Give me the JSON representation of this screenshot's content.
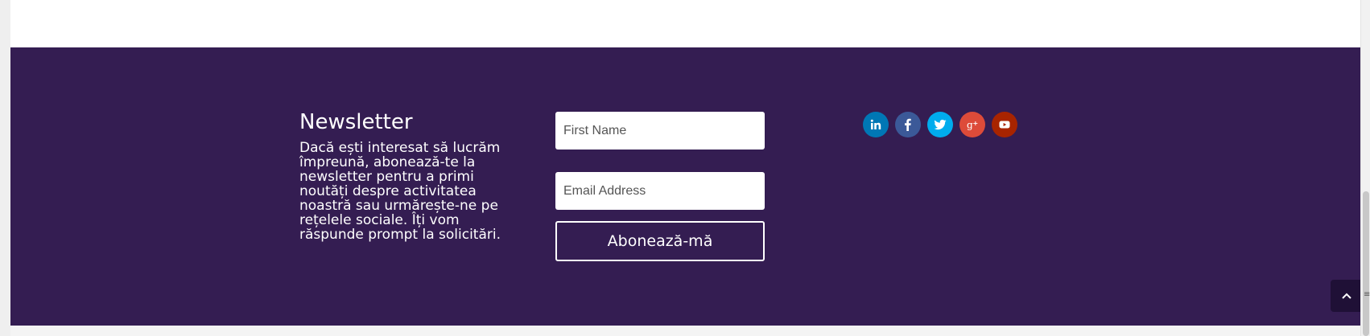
{
  "newsletter": {
    "title": "Newsletter",
    "description": "Dacă ești interesat să lucrăm împreună, abonează-te la newsletter pentru a primi noutăți despre activitatea noastră sau urmărește-ne pe rețelele sociale. Îți vom răspunde prompt la solicitări."
  },
  "form": {
    "first_name_placeholder": "First Name",
    "email_placeholder": "Email Address",
    "subscribe_label": "Abonează-mă"
  },
  "social": [
    {
      "icon": "linkedin-icon",
      "color": "#0077b5"
    },
    {
      "icon": "facebook-icon",
      "color": "#3b5998"
    },
    {
      "icon": "twitter-icon",
      "color": "#00aced"
    },
    {
      "icon": "google-plus-icon",
      "color": "#dd4b39"
    },
    {
      "icon": "youtube-icon",
      "color": "#a82400"
    }
  ],
  "colors": {
    "footer_background": "#341d52",
    "back_to_top_background": "#1f1036"
  },
  "back_to_top": {
    "icon": "chevron-up-icon"
  }
}
